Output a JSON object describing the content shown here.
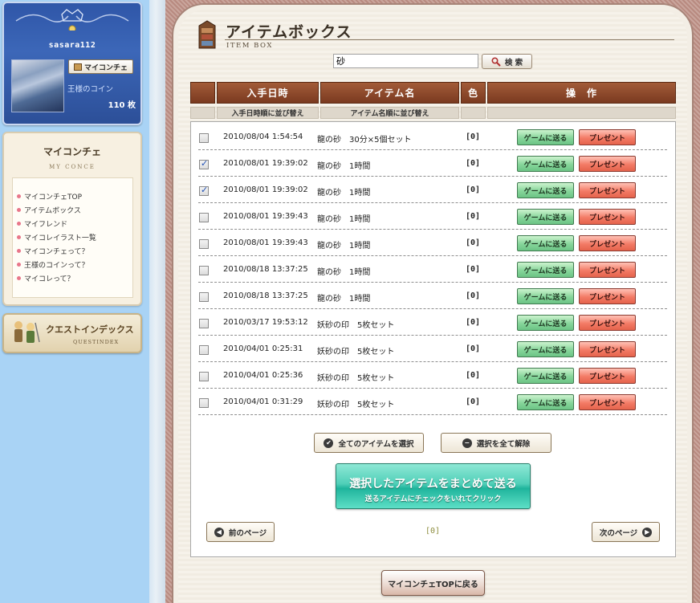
{
  "sidebar": {
    "username": "sasara112",
    "myconcierge_button": "マイコンチェ",
    "coin_label": "王様のコイン",
    "coin_count": "110 枚",
    "menu": {
      "title": "マイコンチェ",
      "subtitle": "MY CONCE",
      "items": [
        {
          "label": "マイコンチェTOP"
        },
        {
          "label": "アイテムボックス"
        },
        {
          "label": "マイフレンド"
        },
        {
          "label": "マイコレイラスト一覧"
        },
        {
          "label": "マイコンチェって？"
        },
        {
          "label": "王様のコインって？"
        },
        {
          "label": "マイコレって？"
        }
      ]
    },
    "questindex": {
      "title": "クエストインデックス",
      "subtitle": "QUESTINDEX"
    }
  },
  "header": {
    "title": "アイテムボックス",
    "subtitle": "ITEM BOX"
  },
  "search": {
    "value": "砂",
    "button_label": "検 索"
  },
  "table": {
    "columns": {
      "date": "入手日時",
      "item": "アイテム名",
      "color": "色",
      "operation": "操　作"
    },
    "sort": {
      "by_date": "入手日時順に並び替え",
      "by_item": "アイテム名順に並び替え"
    },
    "send_to_game": "ゲームに送る",
    "present": "プレゼント",
    "rows": [
      {
        "checked": false,
        "date": "2010/08/04 1:54:54",
        "item": "龍の砂　30分×5個セット",
        "color": "[0]"
      },
      {
        "checked": true,
        "date": "2010/08/01 19:39:02",
        "item": "龍の砂　1時間",
        "color": "[0]"
      },
      {
        "checked": true,
        "date": "2010/08/01 19:39:02",
        "item": "龍の砂　1時間",
        "color": "[0]"
      },
      {
        "checked": false,
        "date": "2010/08/01 19:39:43",
        "item": "龍の砂　1時間",
        "color": "[0]"
      },
      {
        "checked": false,
        "date": "2010/08/01 19:39:43",
        "item": "龍の砂　1時間",
        "color": "[0]"
      },
      {
        "checked": false,
        "date": "2010/08/18 13:37:25",
        "item": "龍の砂　1時間",
        "color": "[0]"
      },
      {
        "checked": false,
        "date": "2010/08/18 13:37:25",
        "item": "龍の砂　1時間",
        "color": "[0]"
      },
      {
        "checked": false,
        "date": "2010/03/17 19:53:12",
        "item": "妖砂の印　5枚セット",
        "color": "[0]"
      },
      {
        "checked": false,
        "date": "2010/04/01 0:25:31",
        "item": "妖砂の印　5枚セット",
        "color": "[0]"
      },
      {
        "checked": false,
        "date": "2010/04/01 0:25:36",
        "item": "妖砂の印　5枚セット",
        "color": "[0]"
      },
      {
        "checked": false,
        "date": "2010/04/01 0:31:29",
        "item": "妖砂の印　5枚セット",
        "color": "[0]"
      }
    ]
  },
  "actions": {
    "select_all": "全てのアイテムを選択",
    "deselect_all": "選択を全て解除",
    "send_selected_main": "選択したアイテムをまとめて送る",
    "send_selected_sub": "送るアイテムにチェックをいれてクリック",
    "prev_page": "前のページ",
    "next_page": "次のページ",
    "page_indicator": "[0]",
    "back_to_top": "マイコンチェTOPに戻る"
  },
  "colors": {
    "sidebar_bg": "#a9d3f5",
    "profile_bg": "#2f56a8",
    "header_bar": "#7a3a20",
    "send_game_green": "#86d59a",
    "present_red": "#f37b66",
    "send_selected_teal": "#1fb49c"
  }
}
